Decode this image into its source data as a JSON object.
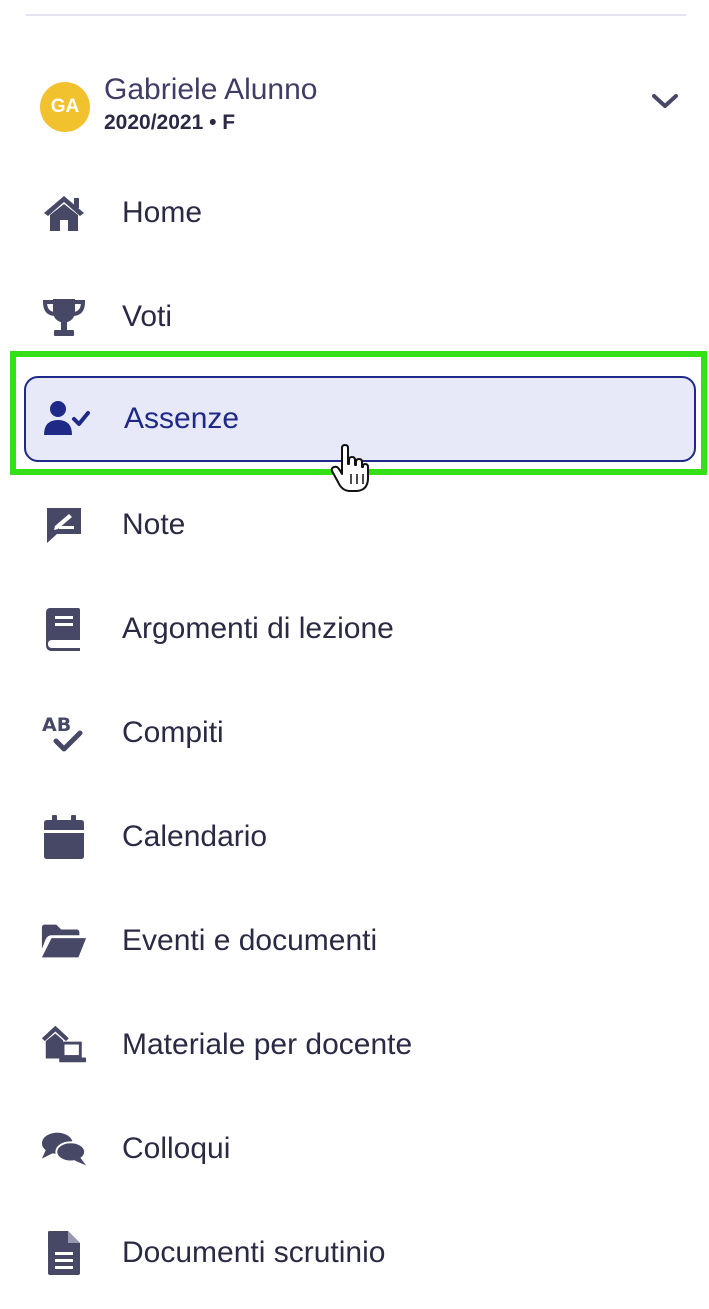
{
  "user": {
    "initials": "GA",
    "name": "Gabriele Alunno",
    "subtitle": "2020/2021 • F"
  },
  "colors": {
    "icon": "#474766",
    "active": "#1f2a88",
    "active_bg": "#e7e8f8",
    "avatar": "#f2c12e",
    "highlight": "#34e016"
  },
  "nav": {
    "items": [
      {
        "label": "Home",
        "icon": "home-icon"
      },
      {
        "label": "Voti",
        "icon": "trophy-icon"
      },
      {
        "label": "Assenze",
        "icon": "user-check-icon",
        "active": true
      },
      {
        "label": "Note",
        "icon": "note-icon"
      },
      {
        "label": "Argomenti di lezione",
        "icon": "book-icon"
      },
      {
        "label": "Compiti",
        "icon": "spell-check-icon"
      },
      {
        "label": "Calendario",
        "icon": "calendar-icon"
      },
      {
        "label": "Eventi e documenti",
        "icon": "folder-open-icon"
      },
      {
        "label": "Materiale per docente",
        "icon": "house-laptop-icon"
      },
      {
        "label": "Colloqui",
        "icon": "comments-icon"
      },
      {
        "label": "Documenti scrutinio",
        "icon": "file-lines-icon"
      }
    ]
  }
}
